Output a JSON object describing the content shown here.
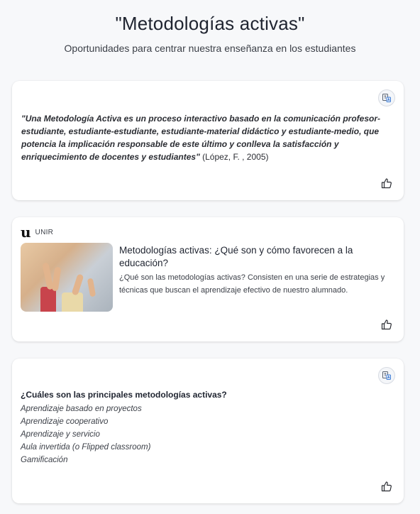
{
  "header": {
    "title": "\"Metodologías activas\"",
    "subtitle": "Oportunidades para centrar nuestra enseñanza en los estudiantes"
  },
  "card1": {
    "quote_text": "\"Una Metodología Activa es un proceso interactivo basado en la comunicación profesor-estudiante, estudiante-estudiante, estudiante-material didáctico y estudiante-medio, que potencia la implicación responsable de este último y conlleva la satisfacción y enriquecimiento de docentes y estudiantes\"",
    "quote_citation": " (López, F. , 2005)",
    "corner_icon": "translate-icon",
    "like_icon": "thumbs-up-icon"
  },
  "card2": {
    "source_logo": "u",
    "source_name": "UNIR",
    "link_title": "Metodologías activas: ¿Qué son y cómo favorecen a la educación?",
    "link_description": "¿Qué son las metodologías activas? Consisten en una serie de estrategias y técnicas que buscan el aprendizaje efectivo de nuestro alumnado.",
    "like_icon": "thumbs-up-icon"
  },
  "card3": {
    "heading": "¿Cuáles son las principales metodologías activas?",
    "items": [
      "Aprendizaje basado en proyectos",
      "Aprendizaje cooperativo",
      "Aprendizaje y servicio",
      "Aula invertida (o Flipped classroom)",
      "Gamificación"
    ],
    "corner_icon": "translate-icon",
    "like_icon": "thumbs-up-icon"
  }
}
